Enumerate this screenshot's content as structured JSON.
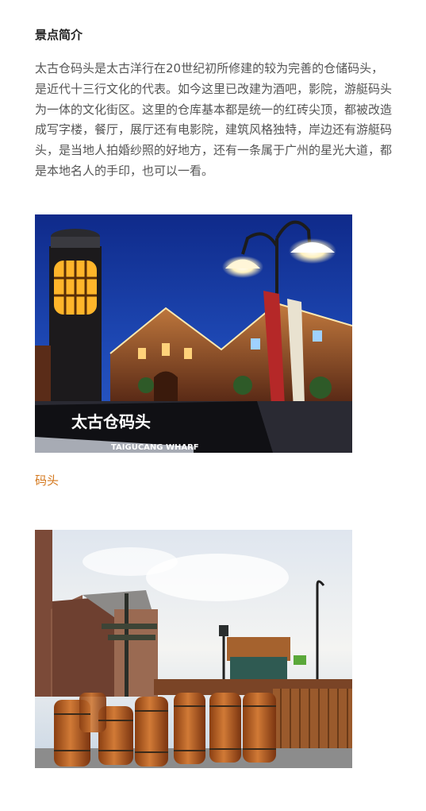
{
  "section": {
    "title": "景点简介",
    "intro": "太古仓码头是太古洋行在20世纪初所修建的较为完善的仓储码头，是近代十三行文化的代表。如今这里已改建为酒吧，影院，游艇码头为一体的文化街区。这里的仓库基本都是统一的红砖尖顶，都被改造成写字楼，餐厅，展厅还有电影院，建筑风格独特，岸边还有游艇码头，是当地人拍婚纱照的好地方，还有一条属于广州的星光大道，都是本地名人的手印，也可以一看。"
  },
  "photo1": {
    "sign_cn": "太古仓码头",
    "sign_en": "TAIGUCANG WHARF",
    "caption": "码头"
  },
  "colors": {
    "caption": "#d4781e",
    "night_sky": "#1a3fa0",
    "brick": "#7a3b22",
    "warm_light": "#ffc74a"
  }
}
